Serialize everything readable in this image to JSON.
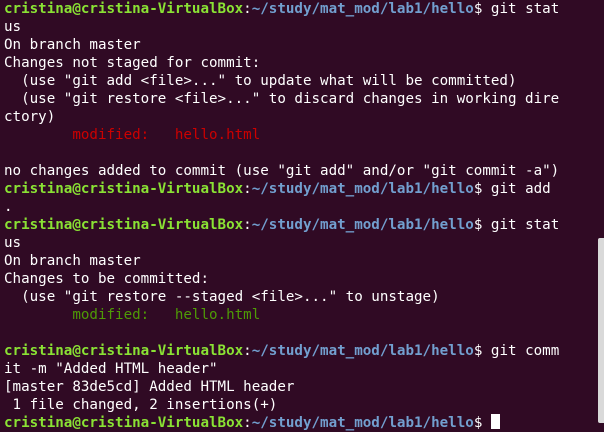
{
  "prompt": {
    "user_host": "cristina@cristina-VirtualBox",
    "colon": ":",
    "path": "~/study/mat_mod/lab1/hello",
    "dollar": "$ "
  },
  "lines": {
    "l1_cmd": "git stat",
    "l2": "us",
    "l3": "On branch master",
    "l4": "Changes not staged for commit:",
    "l5": "  (use \"git add <file>...\" to update what will be committed)",
    "l6": "  (use \"git restore <file>...\" to discard changes in working dire",
    "l7": "ctory)",
    "l8_indent": "        ",
    "l8_status": "modified:   hello.html",
    "l9": "",
    "l10": "no changes added to commit (use \"git add\" and/or \"git commit -a\")",
    "l11_cmd": "git add",
    "l12": ".",
    "l13_cmd": "git stat",
    "l14": "us",
    "l15": "On branch master",
    "l16": "Changes to be committed:",
    "l17": "  (use \"git restore --staged <file>...\" to unstage)",
    "l18_indent": "        ",
    "l18_status": "modified:   hello.html",
    "l19": "",
    "l20_cmd": "git comm",
    "l21": "it -m \"Added HTML header\"",
    "l22": "[master 83de5cd] Added HTML header",
    "l23": " 1 file changed, 2 insertions(+)"
  },
  "colors": {
    "background": "#300a24",
    "user_host": "#8ae234",
    "path": "#729fcf",
    "unstaged": "#cc0000",
    "staged": "#4e9a06",
    "text": "#ffffff"
  },
  "icons": {
    "cursor": "block-cursor"
  }
}
